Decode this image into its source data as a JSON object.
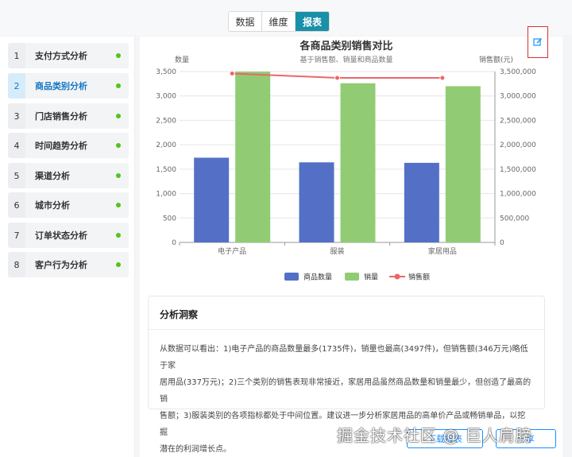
{
  "tabs": [
    {
      "label": "数据"
    },
    {
      "label": "维度"
    },
    {
      "label": "报表"
    }
  ],
  "sidebar": {
    "items": [
      {
        "num": "1",
        "label": "支付方式分析"
      },
      {
        "num": "2",
        "label": "商品类别分析"
      },
      {
        "num": "3",
        "label": "门店销售分析"
      },
      {
        "num": "4",
        "label": "时间趋势分析"
      },
      {
        "num": "5",
        "label": "渠道分析"
      },
      {
        "num": "6",
        "label": "城市分析"
      },
      {
        "num": "7",
        "label": "订单状态分析"
      },
      {
        "num": "8",
        "label": "客户行为分析"
      }
    ]
  },
  "chart_data": {
    "type": "bar",
    "title": "各商品类别销售对比",
    "subtitle": "基于销售额、销量和商品数量",
    "ylabel_left": "数量",
    "ylabel_right": "销售额(元)",
    "categories": [
      "电子产品",
      "服装",
      "家居用品"
    ],
    "ylim_left": [
      0,
      3500
    ],
    "ylim_right": [
      0,
      3500000
    ],
    "left_ticks": [
      "0",
      "500",
      "1,000",
      "1,500",
      "2,000",
      "2,500",
      "3,000",
      "3,500"
    ],
    "right_ticks": [
      "0",
      "500,000",
      "1,000,000",
      "1,500,000",
      "2,000,000",
      "2,500,000",
      "3,000,000",
      "3,500,000"
    ],
    "series": [
      {
        "name": "商品数量",
        "type": "bar",
        "axis": "left",
        "color": "#5470c6",
        "values": [
          1735,
          1640,
          1630
        ]
      },
      {
        "name": "销量",
        "type": "bar",
        "axis": "left",
        "color": "#91cc75",
        "values": [
          3497,
          3260,
          3200
        ]
      },
      {
        "name": "销售额",
        "type": "line",
        "axis": "right",
        "color": "#ee6666",
        "values": [
          3460000,
          3370000,
          3370000
        ]
      }
    ],
    "legend_position": "bottom"
  },
  "insight": {
    "title": "分析洞察",
    "lines": [
      "从数据可以看出：1)电子产品的商品数量最多(1735件)，销量也最高(3497件)，但销售额(346万元)略低于家",
      "居用品(337万元)；2)三个类别的销售表现非常接近，家居用品虽然商品数量和销量最少，但创造了最高的销",
      "售额；3)服装类别的各项指标都处于中间位置。建议进一步分析家居用品的高单价产品或畅销单品，以挖掘",
      "潜在的利润增长点。"
    ]
  },
  "footer": {
    "download_label": "下载报表",
    "share_label": "分享"
  },
  "watermark": "掘金技术社区 @ 巨人肩膀",
  "icons": {
    "edit": "edit-icon"
  }
}
